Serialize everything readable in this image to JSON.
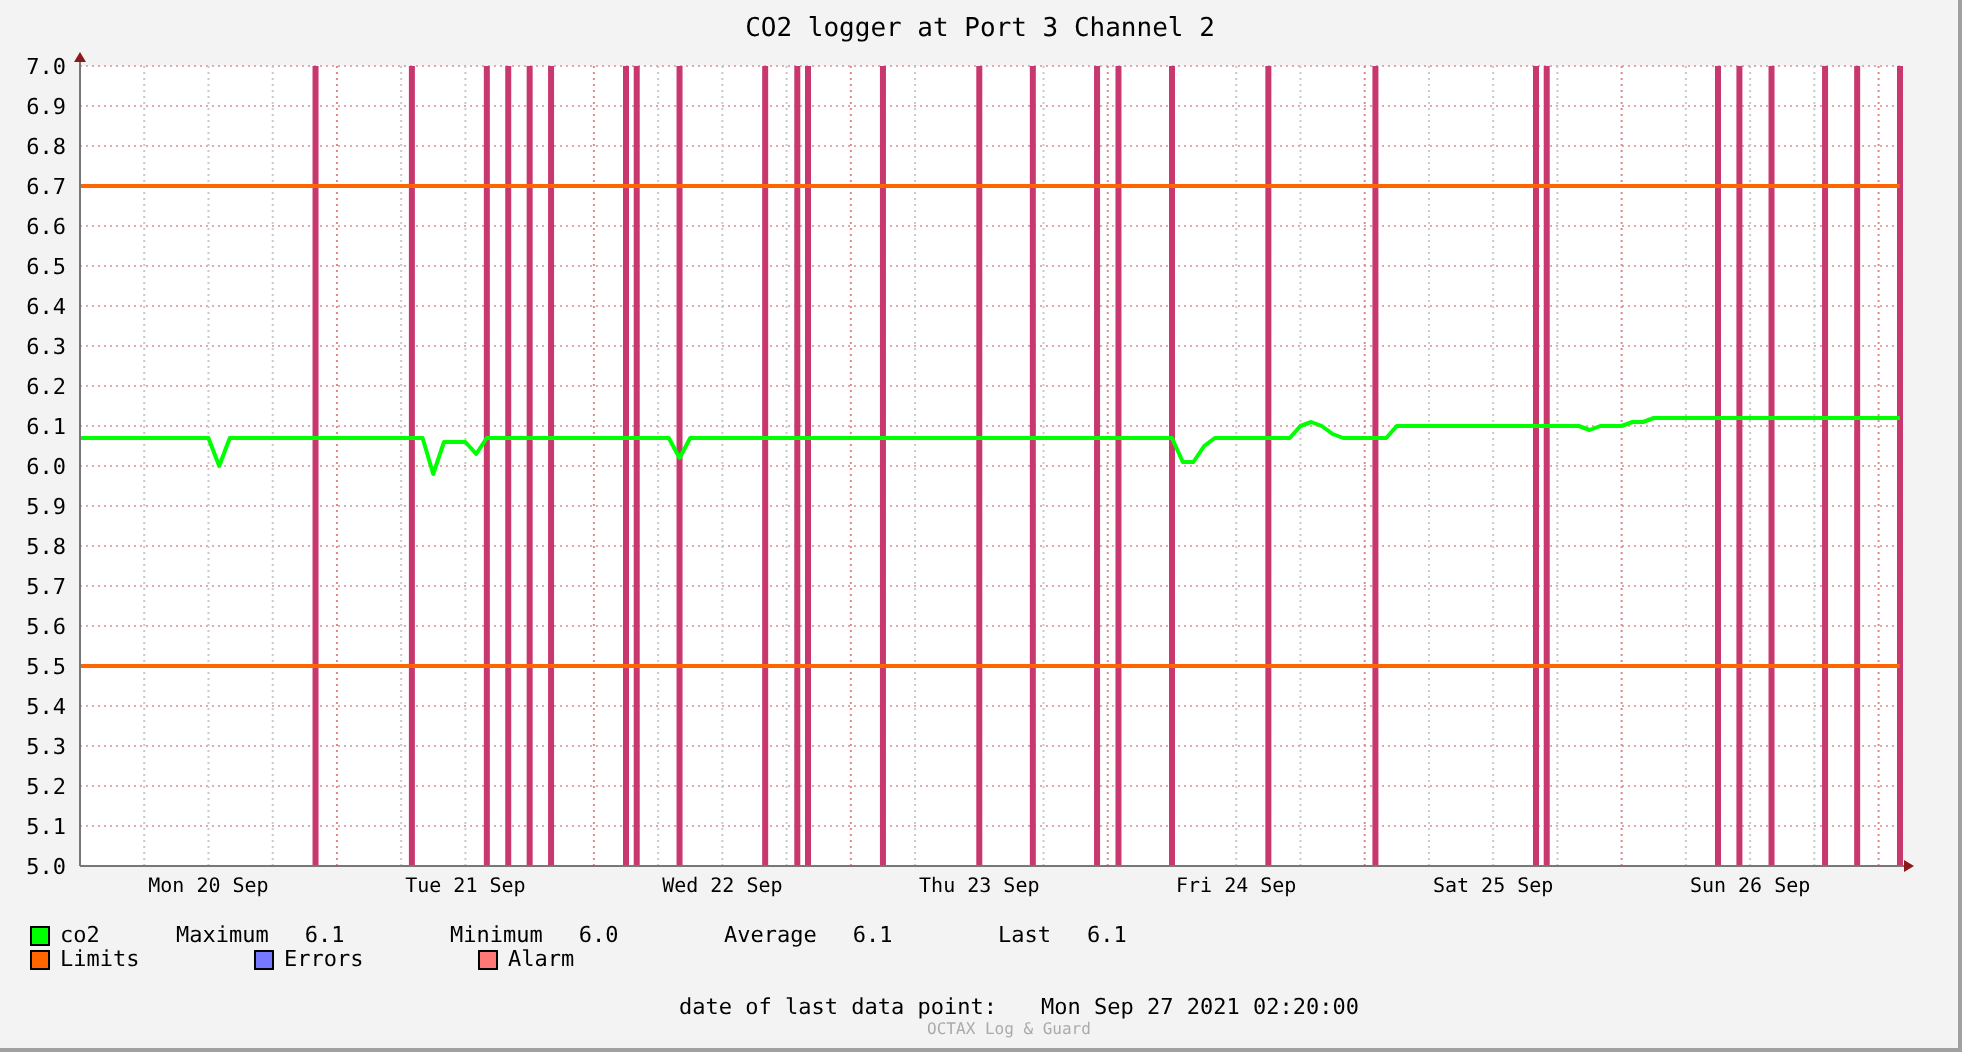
{
  "chart": {
    "chart_data": {
      "type": "line",
      "title": "CO2 logger at Port 3 Channel 2",
      "ylim": [
        5.0,
        7.0
      ],
      "yticks": [
        {
          "value": 5.0,
          "label": "5.0"
        },
        {
          "value": 5.1,
          "label": "5.1"
        },
        {
          "value": 5.2,
          "label": "5.2"
        },
        {
          "value": 5.3,
          "label": "5.3"
        },
        {
          "value": 5.4,
          "label": "5.4"
        },
        {
          "value": 5.5,
          "label": "5.5"
        },
        {
          "value": 5.6,
          "label": "5.6"
        },
        {
          "value": 5.7,
          "label": "5.7"
        },
        {
          "value": 5.8,
          "label": "5.8"
        },
        {
          "value": 5.9,
          "label": "5.9"
        },
        {
          "value": 6.0,
          "label": "6.0"
        },
        {
          "value": 6.1,
          "label": "6.1"
        },
        {
          "value": 6.2,
          "label": "6.2"
        },
        {
          "value": 6.3,
          "label": "6.3"
        },
        {
          "value": 6.4,
          "label": "6.4"
        },
        {
          "value": 6.5,
          "label": "6.5"
        },
        {
          "value": 6.6,
          "label": "6.6"
        },
        {
          "value": 6.7,
          "label": "6.7"
        },
        {
          "value": 6.8,
          "label": "6.8"
        },
        {
          "value": 6.9,
          "label": "6.9"
        },
        {
          "value": 7.0,
          "label": "7.0"
        }
      ],
      "categories": [
        null,
        null,
        null,
        null,
        null,
        null,
        null,
        null,
        null,
        null,
        null,
        null,
        "Mon 20 Sep",
        null,
        null,
        null,
        null,
        null,
        null,
        null,
        null,
        null,
        null,
        null,
        null,
        null,
        null,
        null,
        null,
        null,
        null,
        null,
        null,
        null,
        null,
        null,
        "Tue 21 Sep",
        null,
        null,
        null,
        null,
        null,
        null,
        null,
        null,
        null,
        null,
        null,
        null,
        null,
        null,
        null,
        null,
        null,
        null,
        null,
        null,
        null,
        null,
        null,
        "Wed 22 Sep",
        null,
        null,
        null,
        null,
        null,
        null,
        null,
        null,
        null,
        null,
        null,
        null,
        null,
        null,
        null,
        null,
        null,
        null,
        null,
        null,
        null,
        null,
        null,
        "Thu 23 Sep",
        null,
        null,
        null,
        null,
        null,
        null,
        null,
        null,
        null,
        null,
        null,
        null,
        null,
        null,
        null,
        null,
        null,
        null,
        null,
        null,
        null,
        null,
        null,
        "Fri 24 Sep",
        null,
        null,
        null,
        null,
        null,
        null,
        null,
        null,
        null,
        null,
        null,
        null,
        null,
        null,
        null,
        null,
        null,
        null,
        null,
        null,
        null,
        null,
        null,
        "Sat 25 Sep",
        null,
        null,
        null,
        null,
        null,
        null,
        null,
        null,
        null,
        null,
        null,
        null,
        null,
        null,
        null,
        null,
        null,
        null,
        null,
        null,
        null,
        null,
        null,
        "Sun 26 Sep",
        null,
        null,
        null,
        null,
        null,
        null,
        null,
        null,
        null,
        null,
        null,
        null,
        null,
        null
      ],
      "series": [
        {
          "name": "co2",
          "color": "#00ff00",
          "values": [
            6.07,
            6.07,
            6.07,
            6.07,
            6.07,
            6.07,
            6.07,
            6.07,
            6.07,
            6.07,
            6.07,
            6.07,
            6.07,
            6.0,
            6.07,
            6.07,
            6.07,
            6.07,
            6.07,
            6.07,
            6.07,
            6.07,
            6.07,
            6.07,
            6.07,
            6.07,
            6.07,
            6.07,
            6.07,
            6.07,
            6.07,
            6.07,
            6.07,
            5.98,
            6.06,
            6.06,
            6.06,
            6.03,
            6.07,
            6.07,
            6.07,
            6.07,
            6.07,
            6.07,
            6.07,
            6.07,
            6.07,
            6.07,
            6.07,
            6.07,
            6.07,
            6.07,
            6.07,
            6.07,
            6.07,
            6.07,
            6.02,
            6.07,
            6.07,
            6.07,
            6.07,
            6.07,
            6.07,
            6.07,
            6.07,
            6.07,
            6.07,
            6.07,
            6.07,
            6.07,
            6.07,
            6.07,
            6.07,
            6.07,
            6.07,
            6.07,
            6.07,
            6.07,
            6.07,
            6.07,
            6.07,
            6.07,
            6.07,
            6.07,
            6.07,
            6.07,
            6.07,
            6.07,
            6.07,
            6.07,
            6.07,
            6.07,
            6.07,
            6.07,
            6.07,
            6.07,
            6.07,
            6.07,
            6.07,
            6.07,
            6.07,
            6.07,
            6.07,
            6.01,
            6.01,
            6.05,
            6.07,
            6.07,
            6.07,
            6.07,
            6.07,
            6.07,
            6.07,
            6.07,
            6.1,
            6.11,
            6.1,
            6.08,
            6.07,
            6.07,
            6.07,
            6.07,
            6.07,
            6.1,
            6.1,
            6.1,
            6.1,
            6.1,
            6.1,
            6.1,
            6.1,
            6.1,
            6.1,
            6.1,
            6.1,
            6.1,
            6.1,
            6.1,
            6.1,
            6.1,
            6.1,
            6.09,
            6.1,
            6.1,
            6.1,
            6.11,
            6.11,
            6.12,
            6.12,
            6.12,
            6.12,
            6.12,
            6.12,
            6.12,
            6.12,
            6.12,
            6.12,
            6.12,
            6.12,
            6.12,
            6.12,
            6.12,
            6.12,
            6.12,
            6.12,
            6.12,
            6.12,
            6.12,
            6.12,
            6.12,
            6.12
          ]
        },
        {
          "name": "Alarm",
          "type": "bar",
          "color": "#c8386f",
          "values": [
            null,
            null,
            null,
            null,
            null,
            null,
            null,
            null,
            null,
            null,
            null,
            null,
            null,
            null,
            null,
            null,
            null,
            null,
            null,
            null,
            null,
            null,
            7.0,
            null,
            null,
            null,
            null,
            null,
            null,
            null,
            null,
            7.0,
            null,
            null,
            null,
            null,
            null,
            null,
            7.0,
            null,
            7.0,
            null,
            7.0,
            null,
            7.0,
            null,
            null,
            null,
            null,
            null,
            null,
            7.0,
            7.0,
            null,
            null,
            null,
            7.0,
            null,
            null,
            null,
            null,
            null,
            null,
            null,
            7.0,
            null,
            null,
            7.0,
            7.0,
            null,
            null,
            null,
            null,
            null,
            null,
            7.0,
            null,
            null,
            null,
            null,
            null,
            null,
            null,
            null,
            7.0,
            null,
            null,
            null,
            null,
            7.0,
            null,
            null,
            null,
            null,
            null,
            7.0,
            null,
            7.0,
            null,
            null,
            null,
            null,
            7.0,
            null,
            null,
            null,
            null,
            null,
            null,
            null,
            null,
            7.0,
            null,
            null,
            null,
            null,
            null,
            null,
            null,
            null,
            null,
            7.0,
            null,
            null,
            null,
            null,
            null,
            null,
            null,
            null,
            null,
            null,
            null,
            null,
            null,
            null,
            7.0,
            7.0,
            null,
            null,
            null,
            null,
            null,
            null,
            null,
            null,
            null,
            null,
            null,
            null,
            null,
            null,
            null,
            7.0,
            null,
            7.0,
            null,
            null,
            7.0,
            null,
            null,
            null,
            null,
            7.0,
            null,
            null,
            7.0,
            null,
            null,
            null,
            7.0
          ]
        }
      ],
      "ref_lines": [
        {
          "axis": "y",
          "value": 6.7,
          "color": "#ff6600"
        },
        {
          "axis": "y",
          "value": 5.5,
          "color": "#ff6600"
        }
      ],
      "grid": true
    }
  },
  "legend": {
    "stats": [
      {
        "label": "Maximum",
        "value": "6.1"
      },
      {
        "label": "Minimum",
        "value": "6.0"
      },
      {
        "label": "Average",
        "value": "6.1"
      },
      {
        "label": "Last",
        "value": "6.1"
      }
    ],
    "items": [
      {
        "label": "Limits",
        "color": "#ff6600"
      },
      {
        "label": "Errors",
        "color": "#7777ff"
      },
      {
        "color": "#ff7777"
      }
    ]
  },
  "footer": {
    "label": "date of last data point:",
    "value": "Mon Sep 27 2021 02:20:00",
    "brand": "OCTAX Log & Guard"
  }
}
